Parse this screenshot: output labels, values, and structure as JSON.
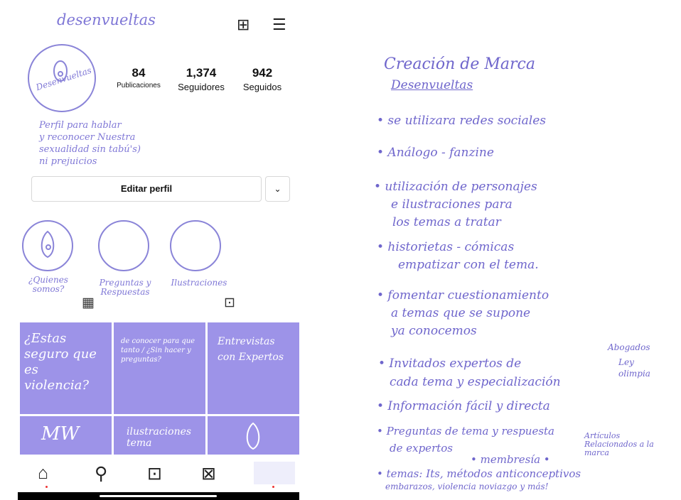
{
  "profile": {
    "username": "desenvueltas",
    "avatar_text": "Desenvueltas",
    "stats": [
      {
        "num": "84",
        "label": "Publicaciones"
      },
      {
        "num": "1,374",
        "label": "Seguidores"
      },
      {
        "num": "942",
        "label": "Seguidos"
      }
    ],
    "bio": [
      "Perfil para hablar",
      "y reconocer Nuestra",
      "sexualidad sin tabú's)",
      "ni prejuicios"
    ],
    "edit_button": "Editar perfil",
    "highlights": [
      "¿Quienes somos?",
      "Preguntas y Respuestas",
      "Ilustraciones"
    ]
  },
  "icons": {
    "new_post": "plus-square-icon",
    "menu": "hamburger-icon",
    "grid_tab": "grid-icon",
    "tagged_tab": "tagged-icon",
    "nav": [
      "home-icon",
      "search-icon",
      "reels-icon",
      "shop-icon",
      "profile-icon"
    ]
  },
  "posts": [
    {
      "text": "¿Estas seguro que es violencia?"
    },
    {
      "text": "de conocer para que tanto / ¿Sin hacer y preguntas?"
    },
    {
      "text": "Entrevistas con Expertos"
    },
    {
      "text": "MW"
    },
    {
      "text": "ilustraciones tema"
    },
    {
      "text": ""
    }
  ],
  "notes": {
    "title": "Creación de Marca",
    "subtitle": "Desenvueltas",
    "items": [
      "• se utilizara redes sociales",
      "• Análogo - fanzine",
      "• utilización de personajes",
      "e ilustraciones para",
      "los temas a tratar",
      "• historietas - cómicas",
      "empatizar con el tema.",
      "• fomentar cuestionamiento",
      "a temas que se supone",
      "ya conocemos",
      "• Invitados expertos de",
      "cada tema y especialización",
      "• Información fácil y directa",
      "• Preguntas de tema y respuesta",
      "de expertos",
      "• membresía •",
      "• temas: Its, métodos anticonceptivos",
      "embarazos, violencia noviazgo y más!"
    ],
    "side_notes": [
      "Abogados",
      "Ley olimpia",
      "Artículos Relacionados a la marca"
    ]
  }
}
